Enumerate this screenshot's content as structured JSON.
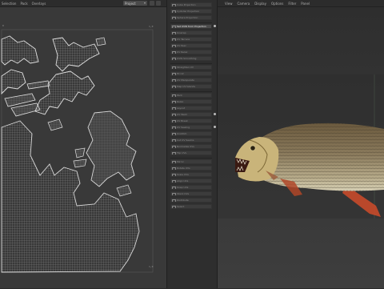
{
  "uv_editor": {
    "menu": [
      "Selection",
      "Pack",
      "Overlays"
    ],
    "mode_value": "Project",
    "corner_top_left": "0",
    "corner_top_right": "1,0",
    "corner_bottom_right": "1,0"
  },
  "tools": {
    "items": [
      {
        "label": "Cube Projection",
        "active": false
      },
      {
        "label": "Cylinder Projection",
        "active": false
      },
      {
        "label": "Sphere Projection",
        "active": false
      },
      {
        "label": "Set UVW from Projection",
        "active": true,
        "badge": true
      },
      {
        "label": "Unwrap",
        "active": false
      },
      {
        "label": "UV Terrace",
        "active": false
      },
      {
        "label": "UV Peel",
        "active": false
      },
      {
        "label": "UV Relax",
        "active": false
      },
      {
        "label": "UVW Smoothing",
        "active": false
      },
      {
        "label": "Straighten UV",
        "active": false
      },
      {
        "label": "Fit UV",
        "active": false
      },
      {
        "label": "UV Manipulate",
        "active": false
      },
      {
        "label": "Map UV Islands",
        "active": false
      },
      {
        "label": "Pack",
        "active": false
      },
      {
        "label": "Relax",
        "active": false
      },
      {
        "label": "Layout",
        "active": false
      },
      {
        "label": "UV Weld",
        "active": false,
        "badge": true
      },
      {
        "label": "UV Break",
        "active": false
      },
      {
        "label": "UV Sewing",
        "active": false,
        "badge": true
      },
      {
        "label": "Unstitch",
        "active": false
      },
      {
        "label": "Cut UV Seams",
        "active": false
      },
      {
        "label": "Normalize UVs",
        "active": false
      },
      {
        "label": "Flip UVs",
        "active": false
      },
      {
        "label": "Mirror",
        "active": false
      },
      {
        "label": "Rotate UVs",
        "active": false
      },
      {
        "label": "Scale UVs",
        "active": false
      },
      {
        "label": "Align UVs",
        "active": false
      },
      {
        "label": "Snap UVs",
        "active": false
      },
      {
        "label": "Stack UVs",
        "active": false
      },
      {
        "label": "Distribute",
        "active": false
      },
      {
        "label": "Select",
        "active": false
      }
    ]
  },
  "viewport": {
    "menu": [
      "View",
      "Camera",
      "Display",
      "Options",
      "Filter",
      "Panel"
    ]
  },
  "colors": {
    "uv_background": "#393939",
    "tool_panel_bg": "#2e2e2e",
    "active_tool": "#4b4b4b",
    "fish_fin": "#c84a2a"
  }
}
